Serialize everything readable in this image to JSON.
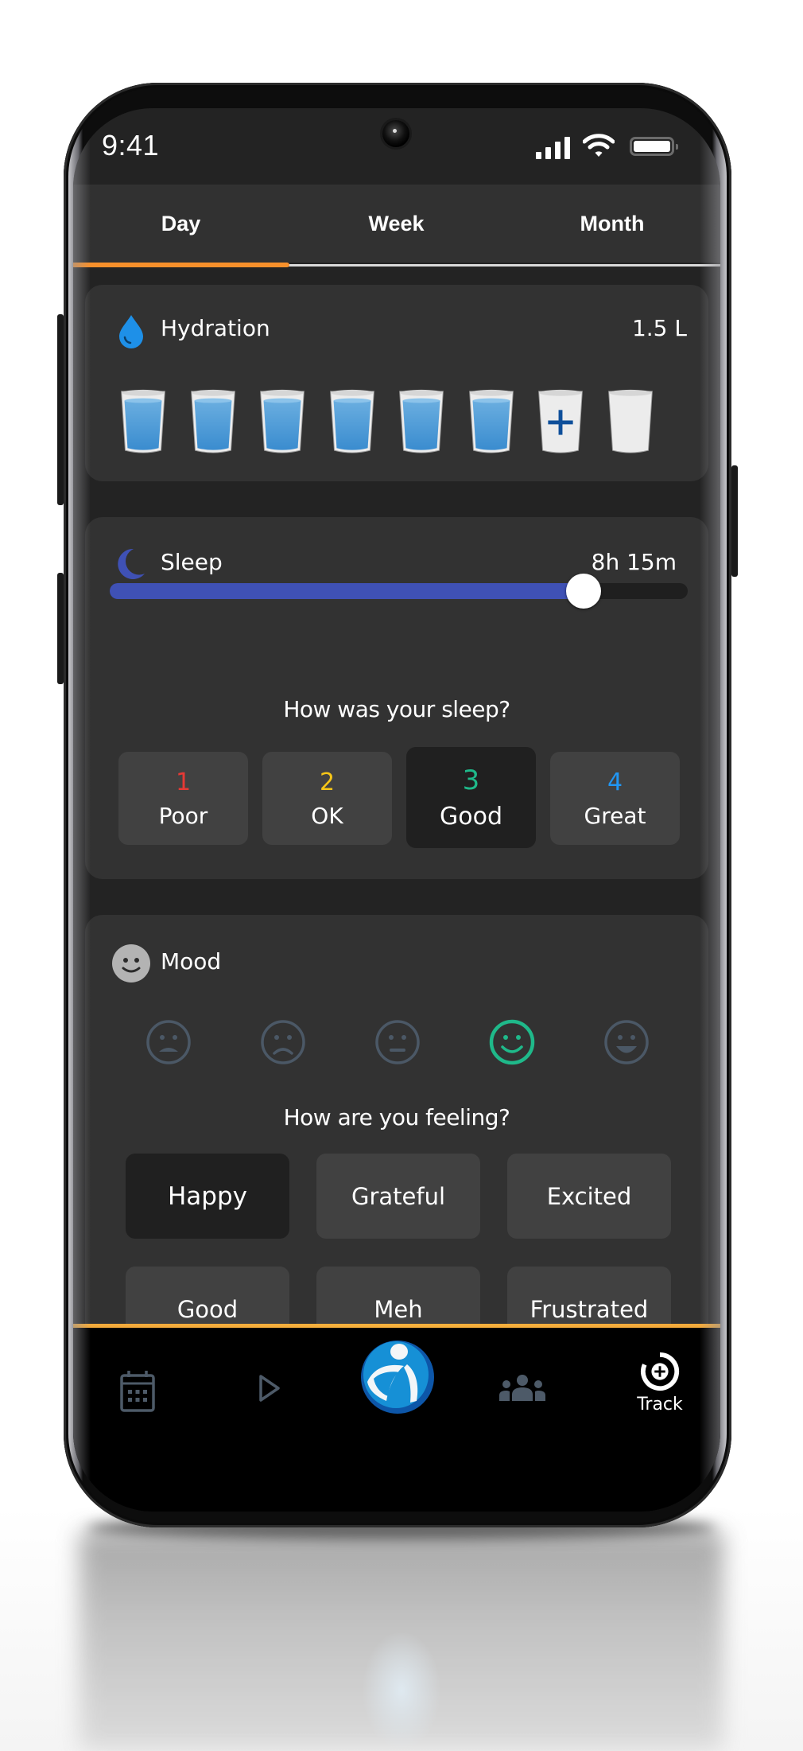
{
  "status_bar": {
    "time": "9:41"
  },
  "tabs": [
    {
      "label": "Day",
      "active": true
    },
    {
      "label": "Week",
      "active": false
    },
    {
      "label": "Month",
      "active": false
    }
  ],
  "hydration": {
    "title": "Hydration",
    "value": "1.5 L",
    "icon": "water-drop-icon",
    "accent": "#1e90e8",
    "glasses": [
      {
        "state": "full"
      },
      {
        "state": "full"
      },
      {
        "state": "full"
      },
      {
        "state": "full"
      },
      {
        "state": "full"
      },
      {
        "state": "full"
      },
      {
        "state": "add"
      },
      {
        "state": "empty"
      }
    ]
  },
  "sleep": {
    "title": "Sleep",
    "value": "8h 15m",
    "icon": "moon-icon",
    "accent": "#3f51b5",
    "slider_fraction": 0.82,
    "question": "How was your sleep?",
    "ratings": [
      {
        "number": "1",
        "label": "Poor",
        "color": "#e53935",
        "selected": false
      },
      {
        "number": "2",
        "label": "OK",
        "color": "#f5c518",
        "selected": false
      },
      {
        "number": "3",
        "label": "Good",
        "color": "#1fb98a",
        "selected": true
      },
      {
        "number": "4",
        "label": "Great",
        "color": "#2196f3",
        "selected": false
      }
    ]
  },
  "mood": {
    "title": "Mood",
    "icon": "smiley-icon",
    "faces": [
      {
        "name": "distressed",
        "selected": false
      },
      {
        "name": "sad",
        "selected": false
      },
      {
        "name": "neutral",
        "selected": false
      },
      {
        "name": "happy",
        "selected": true
      },
      {
        "name": "very-happy",
        "selected": false
      }
    ],
    "face_color": "#4b5866",
    "face_selected_color": "#1fb98a",
    "question": "How are you feeling?",
    "chips": [
      {
        "label": "Happy",
        "selected": true
      },
      {
        "label": "Grateful",
        "selected": false
      },
      {
        "label": "Excited",
        "selected": false
      },
      {
        "label": "Good",
        "selected": false
      },
      {
        "label": "Meh",
        "selected": false
      },
      {
        "label": "Frustrated",
        "selected": false
      }
    ]
  },
  "bottom_nav": {
    "items": [
      {
        "icon": "calendar-icon",
        "label": ""
      },
      {
        "icon": "play-icon",
        "label": ""
      },
      {
        "icon": "app-logo-icon",
        "label": ""
      },
      {
        "icon": "community-icon",
        "label": ""
      },
      {
        "icon": "track-icon",
        "label": "Track",
        "active": true
      }
    ],
    "accent": "#f7b13d"
  }
}
